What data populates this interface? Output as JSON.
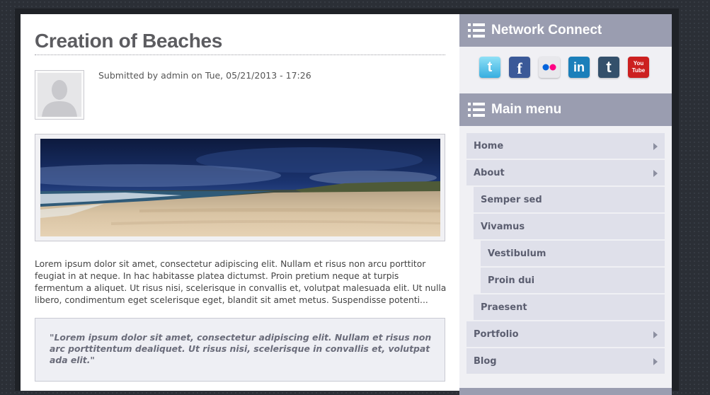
{
  "article": {
    "title": "Creation of Beaches",
    "submitted": "Submitted by admin on Tue, 05/21/2013 - 17:26",
    "body": "Lorem ipsum dolor sit amet, consectetur adipiscing elit. Nullam et risus non arcu porttitor feugiat in at neque. In hac habitasse platea dictumst. Proin pretium neque at turpis fermentum a aliquet. Ut risus nisi, scelerisque in convallis et, volutpat malesuada elit. Ut nulla libero, condimentum eget scelerisque eget, blandit sit amet metus. Suspendisse potenti...",
    "quote": "\"Lorem ipsum dolor sit amet, consectetur adipiscing elit. Nullam et risus non arc porttitentum dealiquet. Ut risus nisi, scelerisque in convallis et, volutpat ada elit.\""
  },
  "sidebar": {
    "network_title": "Network Connect",
    "social": [
      {
        "name": "twitter",
        "glyph": "t",
        "color": "#4fc3e8"
      },
      {
        "name": "facebook",
        "glyph": "f",
        "color": "#3b5998"
      },
      {
        "name": "flickr",
        "glyph": "",
        "color": "#e8e8ec"
      },
      {
        "name": "linkedin",
        "glyph": "in",
        "color": "#1b7fba"
      },
      {
        "name": "tumblr",
        "glyph": "t",
        "color": "#34506b"
      },
      {
        "name": "youtube",
        "glyph": "You Tube",
        "color": "#cc2020"
      }
    ],
    "menu_title": "Main menu",
    "menu": [
      {
        "label": "Home",
        "level": 0,
        "arrow": true
      },
      {
        "label": "About",
        "level": 0,
        "arrow": true
      },
      {
        "label": "Semper sed",
        "level": 1,
        "arrow": false
      },
      {
        "label": "Vivamus",
        "level": 1,
        "arrow": false
      },
      {
        "label": "Vestibulum",
        "level": 2,
        "arrow": false
      },
      {
        "label": "Proin dui",
        "level": 2,
        "arrow": false
      },
      {
        "label": "Praesent",
        "level": 1,
        "arrow": false
      },
      {
        "label": "Portfolio",
        "level": 0,
        "arrow": true
      },
      {
        "label": "Blog",
        "level": 0,
        "arrow": true
      }
    ]
  }
}
